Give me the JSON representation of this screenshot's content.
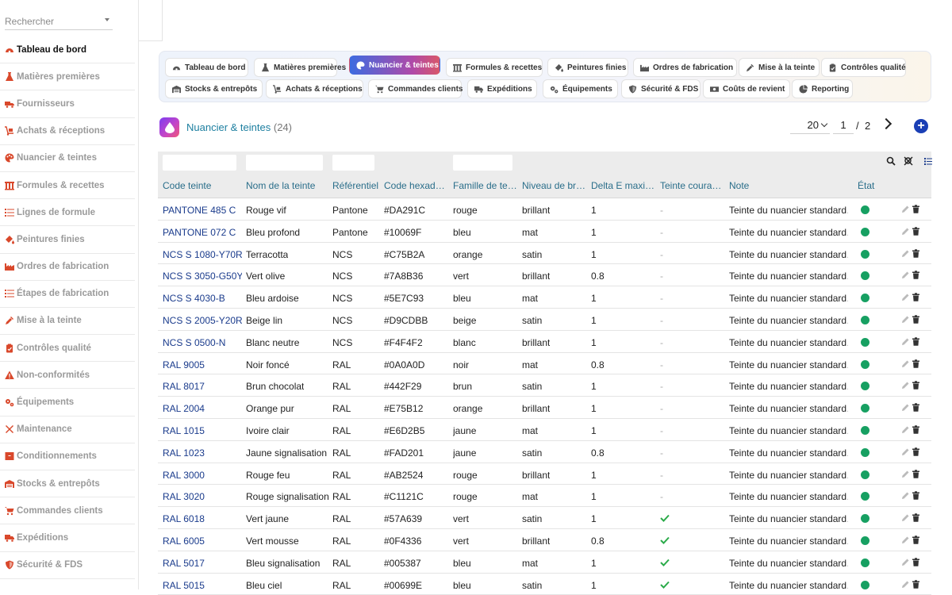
{
  "search": {
    "placeholder": "Rechercher"
  },
  "sidebar": {
    "items": [
      {
        "label": "Tableau de bord",
        "icon": "gauge-icon",
        "active": true
      },
      {
        "label": "Matières premières",
        "icon": "flask-icon"
      },
      {
        "label": "Fournisseurs",
        "icon": "truck-icon"
      },
      {
        "label": "Achats & réceptions",
        "icon": "dolly-icon"
      },
      {
        "label": "Nuancier & teintes",
        "icon": "palette-icon"
      },
      {
        "label": "Formules & recettes",
        "icon": "bars-icon"
      },
      {
        "label": "Lignes de formule",
        "icon": "list-icon"
      },
      {
        "label": "Peintures finies",
        "icon": "fill-drip-icon"
      },
      {
        "label": "Ordres de fabrication",
        "icon": "industry-icon"
      },
      {
        "label": "Étapes de fabrication",
        "icon": "list-ol-icon"
      },
      {
        "label": "Mise à la teinte",
        "icon": "eyedropper-icon"
      },
      {
        "label": "Contrôles qualité",
        "icon": "clipboard-check-icon"
      },
      {
        "label": "Non-conformités",
        "icon": "warning-icon"
      },
      {
        "label": "Équipements",
        "icon": "cogs-icon"
      },
      {
        "label": "Maintenance",
        "icon": "tools-icon"
      },
      {
        "label": "Conditionnements",
        "icon": "box-icon"
      },
      {
        "label": "Stocks & entrepôts",
        "icon": "warehouse-icon"
      },
      {
        "label": "Commandes clients",
        "icon": "cart-icon"
      },
      {
        "label": "Expéditions",
        "icon": "shipping-icon"
      },
      {
        "label": "Sécurité & FDS",
        "icon": "shield-icon"
      }
    ]
  },
  "tabs": [
    {
      "label": "Tableau de bord",
      "icon": "gauge-icon"
    },
    {
      "label": "Matières premières",
      "icon": "flask-icon"
    },
    {
      "label": "Nuancier & teintes",
      "icon": "palette-icon",
      "active": true
    },
    {
      "label": "Formules & recettes",
      "icon": "bars-icon"
    },
    {
      "label": "Peintures finies",
      "icon": "fill-drip-icon"
    },
    {
      "label": "Ordres de fabrication",
      "icon": "industry-icon"
    },
    {
      "label": "Mise à la teinte",
      "icon": "eyedropper-icon"
    },
    {
      "label": "Contrôles qualité",
      "icon": "clipboard-check-icon"
    },
    {
      "label": "Stocks & entrepôts",
      "icon": "warehouse-icon"
    },
    {
      "label": "Achats & réceptions",
      "icon": "dolly-icon"
    },
    {
      "label": "Commandes clients",
      "icon": "cart-icon"
    },
    {
      "label": "Expéditions",
      "icon": "shipping-icon"
    },
    {
      "label": "Équipements",
      "icon": "cogs-icon"
    },
    {
      "label": "Sécurité & FDS",
      "icon": "shield-icon"
    },
    {
      "label": "Coûts de revient",
      "icon": "money-icon"
    },
    {
      "label": "Reporting",
      "icon": "pie-chart-icon"
    }
  ],
  "header": {
    "title": "Nuancier & teintes",
    "count": "(24)"
  },
  "pagination": {
    "page_size": "20",
    "current": "1",
    "separator": "/",
    "total": "2"
  },
  "columns": [
    "Code teinte",
    "Nom de la teinte",
    "Référentiel",
    "Code hexad…",
    "Famille de te…",
    "Niveau de br…",
    "Delta E maxi…",
    "Teinte coura…",
    "Note",
    "État"
  ],
  "rows": [
    {
      "code": "PANTONE 485 C",
      "nom": "Rouge vif",
      "ref": "Pantone",
      "hex": "#DA291C",
      "famille": "rouge",
      "niveau": "brillant",
      "delta": "1",
      "courante": "-",
      "note": "Teinte du nuancier standard…"
    },
    {
      "code": "PANTONE 072 C",
      "nom": "Bleu profond",
      "ref": "Pantone",
      "hex": "#10069F",
      "famille": "bleu",
      "niveau": "mat",
      "delta": "1",
      "courante": "-",
      "note": "Teinte du nuancier standard…"
    },
    {
      "code": "NCS S 1080-Y70R",
      "nom": "Terracotta",
      "ref": "NCS",
      "hex": "#C75B2A",
      "famille": "orange",
      "niveau": "satin",
      "delta": "1",
      "courante": "-",
      "note": "Teinte du nuancier standard…"
    },
    {
      "code": "NCS S 3050-G50Y",
      "nom": "Vert olive",
      "ref": "NCS",
      "hex": "#7A8B36",
      "famille": "vert",
      "niveau": "brillant",
      "delta": "0.8",
      "courante": "-",
      "note": "Teinte du nuancier standard…"
    },
    {
      "code": "NCS S 4030-B",
      "nom": "Bleu ardoise",
      "ref": "NCS",
      "hex": "#5E7C93",
      "famille": "bleu",
      "niveau": "mat",
      "delta": "1",
      "courante": "-",
      "note": "Teinte du nuancier standard…"
    },
    {
      "code": "NCS S 2005-Y20R",
      "nom": "Beige lin",
      "ref": "NCS",
      "hex": "#D9CDBB",
      "famille": "beige",
      "niveau": "satin",
      "delta": "1",
      "courante": "-",
      "note": "Teinte du nuancier standard…"
    },
    {
      "code": "NCS S 0500-N",
      "nom": "Blanc neutre",
      "ref": "NCS",
      "hex": "#F4F4F2",
      "famille": "blanc",
      "niveau": "brillant",
      "delta": "1",
      "courante": "-",
      "note": "Teinte du nuancier standard…"
    },
    {
      "code": "RAL 9005",
      "nom": "Noir foncé",
      "ref": "RAL",
      "hex": "#0A0A0D",
      "famille": "noir",
      "niveau": "mat",
      "delta": "0.8",
      "courante": "-",
      "note": "Teinte du nuancier standard…"
    },
    {
      "code": "RAL 8017",
      "nom": "Brun chocolat",
      "ref": "RAL",
      "hex": "#442F29",
      "famille": "brun",
      "niveau": "satin",
      "delta": "1",
      "courante": "-",
      "note": "Teinte du nuancier standard…"
    },
    {
      "code": "RAL 2004",
      "nom": "Orange pur",
      "ref": "RAL",
      "hex": "#E75B12",
      "famille": "orange",
      "niveau": "brillant",
      "delta": "1",
      "courante": "-",
      "note": "Teinte du nuancier standard…"
    },
    {
      "code": "RAL 1015",
      "nom": "Ivoire clair",
      "ref": "RAL",
      "hex": "#E6D2B5",
      "famille": "jaune",
      "niveau": "mat",
      "delta": "1",
      "courante": "-",
      "note": "Teinte du nuancier standard…"
    },
    {
      "code": "RAL 1023",
      "nom": "Jaune signalisation",
      "ref": "RAL",
      "hex": "#FAD201",
      "famille": "jaune",
      "niveau": "satin",
      "delta": "0.8",
      "courante": "-",
      "note": "Teinte du nuancier standard…"
    },
    {
      "code": "RAL 3000",
      "nom": "Rouge feu",
      "ref": "RAL",
      "hex": "#AB2524",
      "famille": "rouge",
      "niveau": "brillant",
      "delta": "1",
      "courante": "-",
      "note": "Teinte du nuancier standard…"
    },
    {
      "code": "RAL 3020",
      "nom": "Rouge signalisation",
      "ref": "RAL",
      "hex": "#C1121C",
      "famille": "rouge",
      "niveau": "mat",
      "delta": "1",
      "courante": "-",
      "note": "Teinte du nuancier standard…"
    },
    {
      "code": "RAL 6018",
      "nom": "Vert jaune",
      "ref": "RAL",
      "hex": "#57A639",
      "famille": "vert",
      "niveau": "satin",
      "delta": "1",
      "courante": "check",
      "note": "Teinte du nuancier standard…"
    },
    {
      "code": "RAL 6005",
      "nom": "Vert mousse",
      "ref": "RAL",
      "hex": "#0F4336",
      "famille": "vert",
      "niveau": "brillant",
      "delta": "0.8",
      "courante": "check",
      "note": "Teinte du nuancier standard…"
    },
    {
      "code": "RAL 5017",
      "nom": "Bleu signalisation",
      "ref": "RAL",
      "hex": "#005387",
      "famille": "bleu",
      "niveau": "mat",
      "delta": "1",
      "courante": "check",
      "note": "Teinte du nuancier standard…"
    },
    {
      "code": "RAL 5015",
      "nom": "Bleu ciel",
      "ref": "RAL",
      "hex": "#00699E",
      "famille": "bleu",
      "niveau": "satin",
      "delta": "1",
      "courante": "check",
      "note": "Teinte du nuancier standard…"
    }
  ],
  "colors": {
    "accent": "#1d7fa0",
    "link": "#1a3b8c",
    "status_ok": "#17a062",
    "check": "#2bab4a",
    "sidebar_icon": "#d9482b"
  }
}
